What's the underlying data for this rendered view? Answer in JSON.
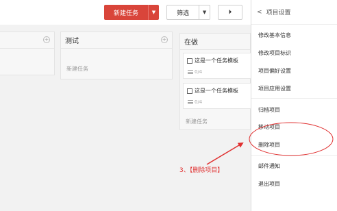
{
  "toolbar": {
    "new_task_label": "新建任务",
    "filter_label": "筛选",
    "collapse_glyph": "⏵"
  },
  "board": {
    "columns": [
      {
        "title": ""
      },
      {
        "title": "测试",
        "new_task": "新建任务"
      },
      {
        "title": "在做",
        "cards": [
          {
            "title": "这是一个任务模板",
            "progress": "0/4"
          },
          {
            "title": "这是一个任务模板",
            "progress": "0/4"
          }
        ],
        "new_task": "新建任务"
      }
    ]
  },
  "panel": {
    "title": "项目设置",
    "items": [
      "修改基本信息",
      "修改项目标识",
      "项目偏好设置",
      "项目应用设置",
      "归档项目",
      "移动项目",
      "删除项目",
      "邮件通知",
      "退出项目"
    ]
  },
  "annotation": {
    "text": "3、【删除项目】",
    "color": "#e03030"
  },
  "colors": {
    "primary": "#d9453a",
    "board_bg": "#f2f2f2"
  }
}
